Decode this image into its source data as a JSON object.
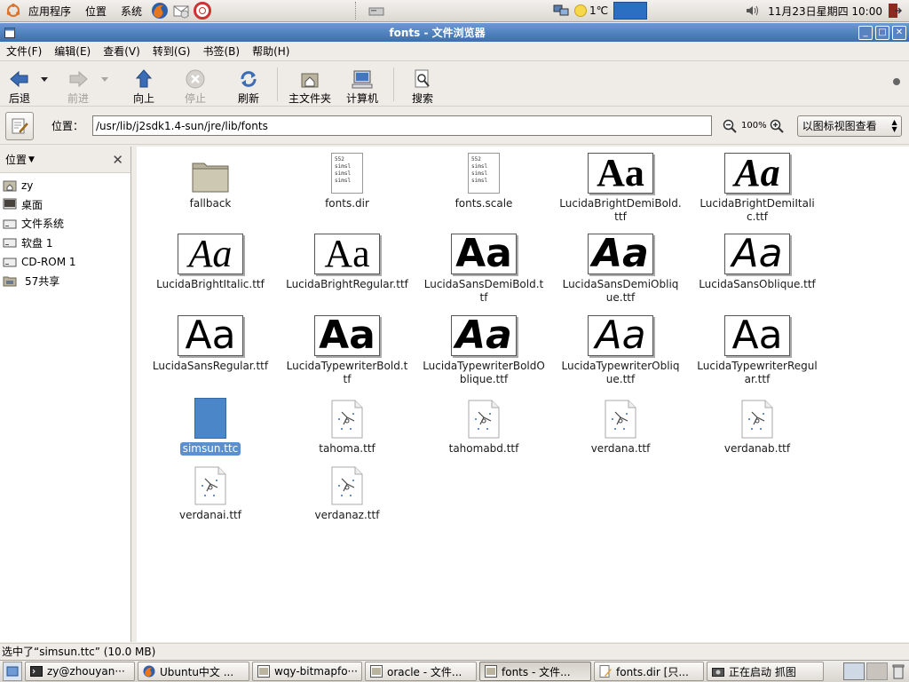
{
  "top_panel": {
    "menus": [
      "应用程序",
      "位置",
      "系统"
    ],
    "temperature": "1℃",
    "clock": "11月23日星期四  10:00"
  },
  "window": {
    "title": "fonts - 文件浏览器"
  },
  "menubar": [
    {
      "label": "文件(F)"
    },
    {
      "label": "编辑(E)"
    },
    {
      "label": "查看(V)"
    },
    {
      "label": "转到(G)"
    },
    {
      "label": "书签(B)"
    },
    {
      "label": "帮助(H)"
    }
  ],
  "toolbar": {
    "back": "后退",
    "forward": "前进",
    "up": "向上",
    "stop": "停止",
    "reload": "刷新",
    "home": "主文件夹",
    "computer": "计算机",
    "search": "搜索"
  },
  "location": {
    "label": "位置：",
    "path": "/usr/lib/j2sdk1.4-sun/jre/lib/fonts",
    "zoom": "100%",
    "view_mode": "以图标视图查看"
  },
  "sidebar": {
    "title": "位置",
    "items": [
      {
        "label": "zy",
        "icon": "home-icon"
      },
      {
        "label": "桌面",
        "icon": "desktop-icon"
      },
      {
        "label": "文件系统",
        "icon": "drive-icon"
      },
      {
        "label": "软盘 1",
        "icon": "floppy-icon"
      },
      {
        "label": "CD-ROM 1",
        "icon": "cdrom-icon"
      },
      {
        "label": "57共享",
        "icon": "network-folder-icon"
      }
    ]
  },
  "files": [
    {
      "name": "fallback",
      "type": "folder"
    },
    {
      "name": "fonts.dir",
      "type": "text",
      "preview": "552\nsimsl\nsimsl\nsimsl"
    },
    {
      "name": "fonts.scale",
      "type": "text",
      "preview": "552\nsimsl\nsimsl\nsimsl"
    },
    {
      "name": "LucidaBrightDemiBold.ttf",
      "type": "font",
      "family": "serif",
      "weight": "bold",
      "style": "normal"
    },
    {
      "name": "LucidaBrightDemiItalic.ttf",
      "type": "font",
      "family": "serif",
      "weight": "bold",
      "style": "italic"
    },
    {
      "name": "LucidaBrightItalic.ttf",
      "type": "font",
      "family": "serif",
      "weight": "normal",
      "style": "italic"
    },
    {
      "name": "LucidaBrightRegular.ttf",
      "type": "font",
      "family": "serif",
      "weight": "normal",
      "style": "normal"
    },
    {
      "name": "LucidaSansDemiBold.ttf",
      "type": "font",
      "family": "sans",
      "weight": "bold",
      "style": "normal"
    },
    {
      "name": "LucidaSansDemiOblique.ttf",
      "type": "font",
      "family": "sans",
      "weight": "bold",
      "style": "italic"
    },
    {
      "name": "LucidaSansOblique.ttf",
      "type": "font",
      "family": "sans",
      "weight": "normal",
      "style": "italic"
    },
    {
      "name": "LucidaSansRegular.ttf",
      "type": "font",
      "family": "sans",
      "weight": "normal",
      "style": "normal"
    },
    {
      "name": "LucidaTypewriterBold.ttf",
      "type": "font",
      "family": "sans",
      "weight": "bold",
      "style": "normal"
    },
    {
      "name": "LucidaTypewriterBoldOblique.ttf",
      "type": "font",
      "family": "sans",
      "weight": "bold",
      "style": "italic"
    },
    {
      "name": "LucidaTypewriterOblique.ttf",
      "type": "font",
      "family": "sans",
      "weight": "normal",
      "style": "italic"
    },
    {
      "name": "LucidaTypewriterRegular.ttf",
      "type": "font",
      "family": "sans",
      "weight": "normal",
      "style": "normal"
    },
    {
      "name": "simsun.ttc",
      "type": "ttc",
      "selected": true
    },
    {
      "name": "tahoma.ttf",
      "type": "ttf-generic"
    },
    {
      "name": "tahomabd.ttf",
      "type": "ttf-generic"
    },
    {
      "name": "verdana.ttf",
      "type": "ttf-generic"
    },
    {
      "name": "verdanab.ttf",
      "type": "ttf-generic"
    },
    {
      "name": "verdanai.ttf",
      "type": "ttf-generic"
    },
    {
      "name": "verdanaz.ttf",
      "type": "ttf-generic"
    }
  ],
  "font_preview_text": "Aa",
  "status": "选中了“simsun.ttc” (10.0 MB)",
  "taskbar": [
    {
      "label": "zy@zhouyan···",
      "icon": "terminal-icon",
      "active": false
    },
    {
      "label": "Ubuntu中文 ...",
      "icon": "firefox-icon",
      "active": false
    },
    {
      "label": "wqy-bitmapfo···",
      "icon": "folder-window-icon",
      "active": false
    },
    {
      "label": "oracle - 文件...",
      "icon": "folder-window-icon",
      "active": false
    },
    {
      "label": "fonts - 文件...",
      "icon": "folder-window-icon",
      "active": true
    },
    {
      "label": "fonts.dir [只...",
      "icon": "text-editor-icon",
      "active": false
    },
    {
      "label": "正在启动 抓图",
      "icon": "camera-icon",
      "active": false
    }
  ],
  "colors": {
    "titlebar": "#3c6fae",
    "selection": "#5a90cf",
    "panel": "#efebe7"
  }
}
